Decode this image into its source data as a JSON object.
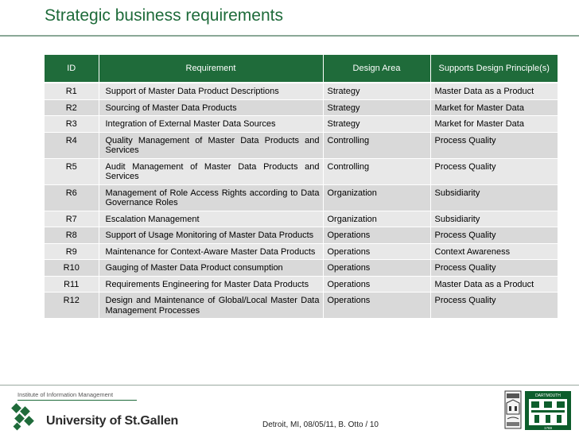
{
  "title": "Strategic business requirements",
  "table": {
    "headers": {
      "id": "ID",
      "requirement": "Requirement",
      "design_area": "Design Area",
      "principle": "Supports Design Principle(s)"
    },
    "rows": [
      {
        "id": "R1",
        "requirement": "Support of Master Data Product Descriptions",
        "area": "Strategy",
        "principle": "Master Data as a Product"
      },
      {
        "id": "R2",
        "requirement": "Sourcing of Master Data Products",
        "area": "Strategy",
        "principle": "Market for Master Data"
      },
      {
        "id": "R3",
        "requirement": "Integration of External Master Data Sources",
        "area": "Strategy",
        "principle": "Market for Master Data"
      },
      {
        "id": "R4",
        "requirement": "Quality Management of Master Data Products and Services",
        "area": "Controlling",
        "principle": "Process Quality"
      },
      {
        "id": "R5",
        "requirement": "Audit Management of Master Data Products and Services",
        "area": "Controlling",
        "principle": "Process Quality"
      },
      {
        "id": "R6",
        "requirement": "Management of Role Access Rights according to Data Governance Roles",
        "area": "Organization",
        "principle": "Subsidiarity"
      },
      {
        "id": "R7",
        "requirement": "Escalation Management",
        "area": "Organization",
        "principle": "Subsidiarity"
      },
      {
        "id": "R8",
        "requirement": "Support of Usage Monitoring of Master Data Products",
        "area": "Operations",
        "principle": "Process Quality"
      },
      {
        "id": "R9",
        "requirement": "Maintenance for Context-Aware Master Data Products",
        "area": "Operations",
        "principle": "Context Awareness"
      },
      {
        "id": "R10",
        "requirement": "Gauging of Master Data Product consumption",
        "area": "Operations",
        "principle": "Process Quality"
      },
      {
        "id": "R11",
        "requirement": "Requirements Engineering for Master Data Products",
        "area": "Operations",
        "principle": "Master Data as a Product"
      },
      {
        "id": "R12",
        "requirement": "Design and Maintenance of Global/Local Master Data Management Processes",
        "area": "Operations",
        "principle": "Process Quality"
      }
    ]
  },
  "footer": {
    "institute": "Institute of Information Management",
    "university": "University of St.Gallen",
    "text": "Detroit, MI, 08/05/11, B. Otto / 10",
    "crest_label": "DARTMOUTH",
    "crest_year": "1769"
  },
  "colors": {
    "brand_green": "#1f6b3a",
    "title_green": "#1e6b3a",
    "row_light": "#e8e8e8",
    "row_dark": "#d9d9d9"
  }
}
